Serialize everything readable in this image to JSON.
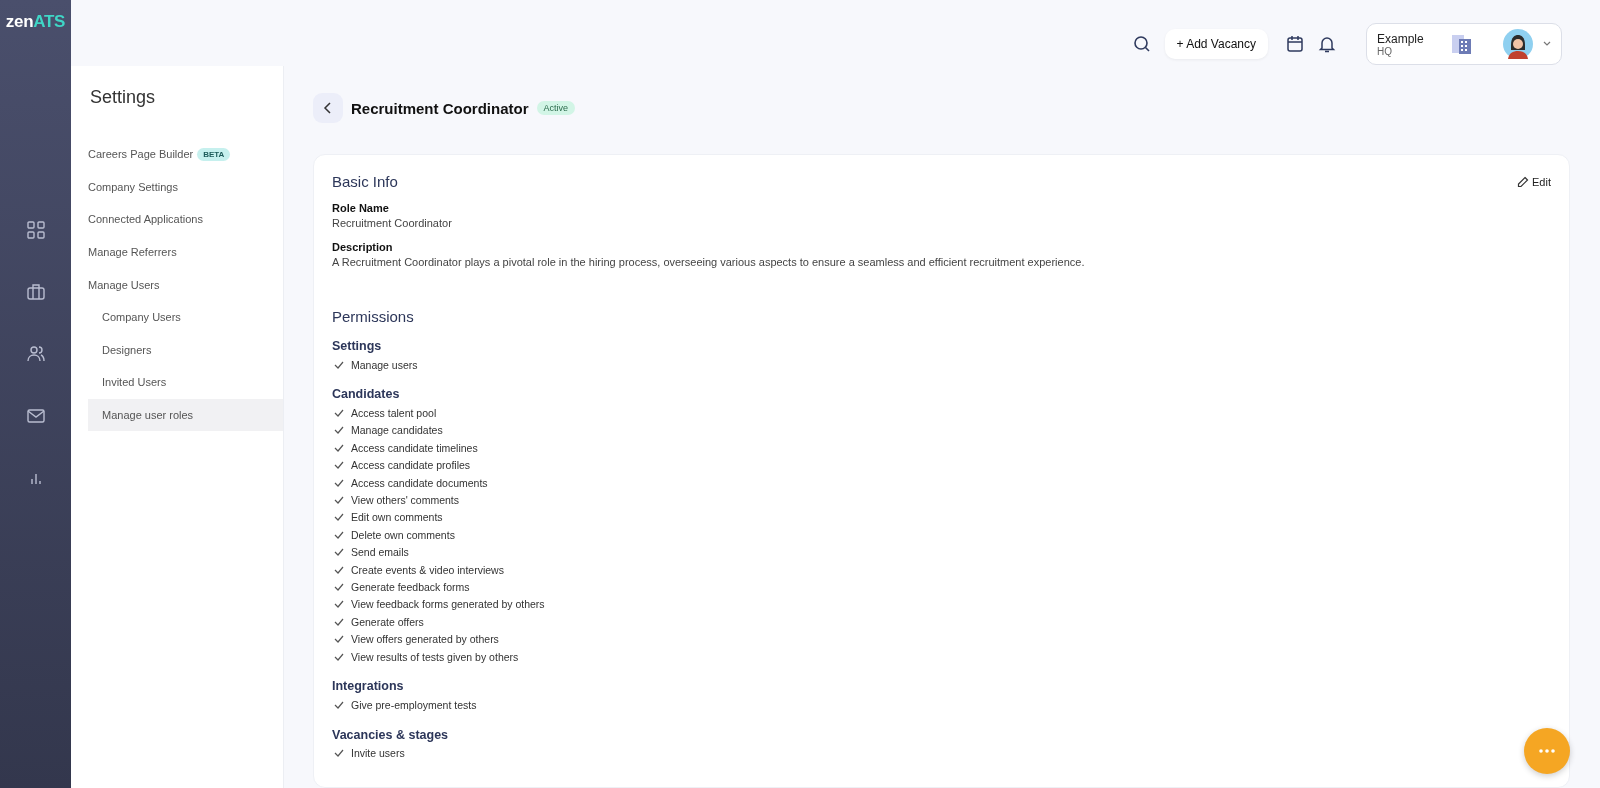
{
  "logo": {
    "first": "zen",
    "second": "ATS"
  },
  "rail": [
    {
      "kind": "grid",
      "selected": false
    },
    {
      "kind": "briefcase",
      "selected": false
    },
    {
      "kind": "people",
      "selected": false
    },
    {
      "kind": "mail",
      "selected": false
    },
    {
      "kind": "chart",
      "selected": false
    }
  ],
  "topbar": {
    "add_button": "+ Add Vacancy",
    "company": {
      "name": "Example",
      "location": "HQ"
    }
  },
  "settings": {
    "title": "Settings",
    "items": [
      {
        "label": "Careers Page Builder",
        "badge": "BETA",
        "selected": false
      },
      {
        "label": "Company Settings",
        "selected": false
      },
      {
        "label": "Connected Applications",
        "selected": false
      },
      {
        "label": "Manage Referrers",
        "selected": false
      },
      {
        "label": "Manage Users",
        "selected": false,
        "children": [
          {
            "label": "Company Users",
            "selected": false
          },
          {
            "label": "Designers",
            "selected": false
          },
          {
            "label": "Invited Users",
            "selected": false
          },
          {
            "label": "Manage user roles",
            "selected": true
          }
        ]
      }
    ]
  },
  "role": {
    "title": "Recruitment Coordinator",
    "status": "Active"
  },
  "basic_info": {
    "title": "Basic Info",
    "edit": "Edit",
    "fields": [
      {
        "label": "Role Name",
        "value": "Recruitment Coordinator"
      },
      {
        "label": "Description",
        "value": "A Recruitment Coordinator plays a pivotal role in the hiring process, overseeing various aspects to ensure a seamless and efficient recruitment experience."
      }
    ]
  },
  "permissions": {
    "title": "Permissions",
    "groups": [
      {
        "name": "Settings",
        "items": [
          "Manage users"
        ]
      },
      {
        "name": "Candidates",
        "items": [
          "Access talent pool",
          "Manage candidates",
          "Access candidate timelines",
          "Access candidate profiles",
          "Access candidate documents",
          "View others' comments",
          "Edit own comments",
          "Delete own comments",
          "Send emails",
          "Create events & video interviews",
          "Generate feedback forms",
          "View feedback forms generated by others",
          "Generate offers",
          "View offers generated by others",
          "View results of tests given by others"
        ]
      },
      {
        "name": "Integrations",
        "items": [
          "Give pre-employment tests"
        ]
      },
      {
        "name": "Vacancies & stages",
        "items": [
          "Invite users"
        ]
      }
    ]
  }
}
